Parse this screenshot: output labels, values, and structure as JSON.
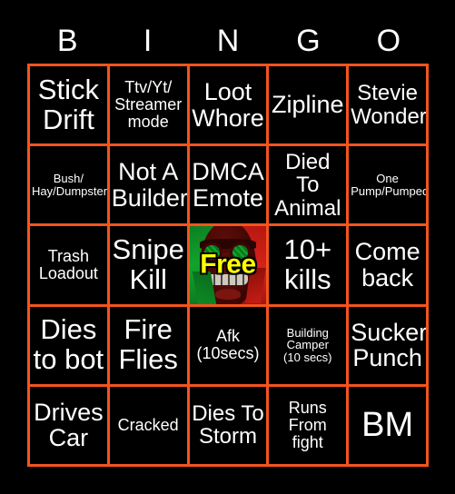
{
  "card": {
    "header_letters": [
      "B",
      "I",
      "N",
      "G",
      "O"
    ],
    "border_color": "#f4541e",
    "background_color": "#000000",
    "text_color": "#ffffff",
    "free_text_color": "#ffff00"
  },
  "grid": {
    "columns": 5,
    "rows": 5,
    "cells": [
      {
        "text": "Stick Drift",
        "size": "fs-xl",
        "type": "square"
      },
      {
        "text": "Ttv/Yt/\nStreamer\nmode",
        "size": "fs-sm",
        "type": "square"
      },
      {
        "text": "Loot Whore",
        "size": "fs-lg",
        "type": "square"
      },
      {
        "text": "Zipline",
        "size": "fs-lg",
        "type": "square"
      },
      {
        "text": "Stevie Wonder",
        "size": "fs-md",
        "type": "square"
      },
      {
        "text": "Bush/\nHay/Dumpster",
        "size": "fs-xs",
        "type": "square"
      },
      {
        "text": "Not A Builder",
        "size": "fs-lg",
        "type": "square"
      },
      {
        "text": "DMCA Emote",
        "size": "fs-lg",
        "type": "square"
      },
      {
        "text": "Died To Animal",
        "size": "fs-md",
        "type": "square"
      },
      {
        "text": "One Pump/Pumped",
        "size": "fs-xs",
        "type": "square"
      },
      {
        "text": "Trash Loadout",
        "size": "fs-sm",
        "type": "square"
      },
      {
        "text": "Snipe Kill",
        "size": "fs-xl",
        "type": "square"
      },
      {
        "text": "Free",
        "size": "fs-lg",
        "type": "free"
      },
      {
        "text": "10+ kills",
        "size": "fs-xl",
        "type": "square"
      },
      {
        "text": "Come back",
        "size": "fs-lg",
        "type": "square"
      },
      {
        "text": "Dies to bot",
        "size": "fs-xl",
        "type": "square"
      },
      {
        "text": "Fire Flies",
        "size": "fs-xl",
        "type": "square"
      },
      {
        "text": "Afk\n(10secs)",
        "size": "fs-sm",
        "type": "square"
      },
      {
        "text": "Building Camper\n(10 secs)",
        "size": "fs-xs",
        "type": "square"
      },
      {
        "text": "Sucker Punch",
        "size": "fs-lg",
        "type": "square"
      },
      {
        "text": "Drives Car",
        "size": "fs-lg",
        "type": "square"
      },
      {
        "text": "Cracked",
        "size": "fs-sm",
        "type": "square"
      },
      {
        "text": "Dies To Storm",
        "size": "fs-md",
        "type": "square"
      },
      {
        "text": "Runs From fight",
        "size": "fs-sm",
        "type": "square"
      },
      {
        "text": "BM",
        "size": "fs-xxl",
        "type": "square"
      }
    ]
  }
}
